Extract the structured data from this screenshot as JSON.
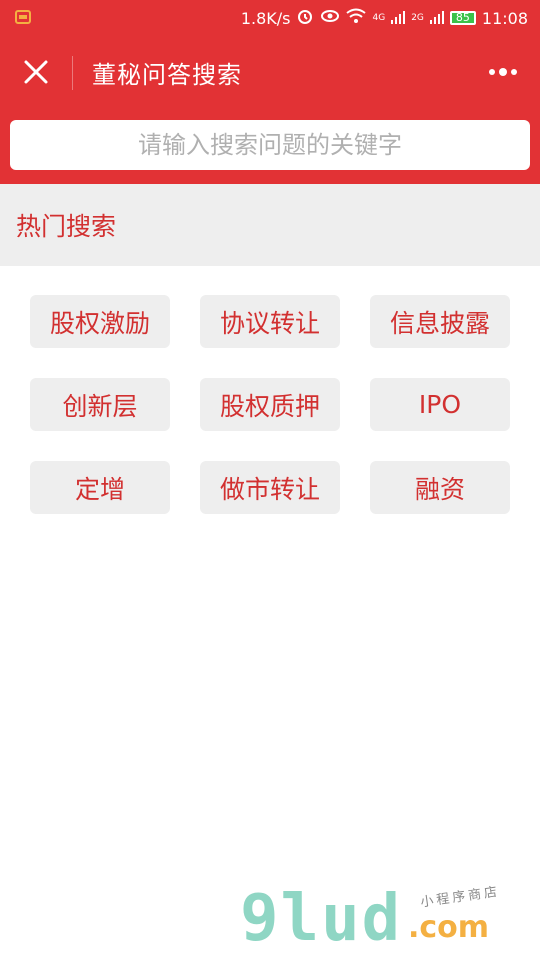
{
  "status_bar": {
    "network_speed": "1.8K/s",
    "net_type_1": "4G",
    "net_type_2": "2G",
    "battery": "85",
    "time": "11:08"
  },
  "navbar": {
    "title": "董秘问答搜索"
  },
  "search": {
    "placeholder": "请输入搜索问题的关键字"
  },
  "hot_search": {
    "title": "热门搜索",
    "tags": [
      "股权激励",
      "协议转让",
      "信息披露",
      "创新层",
      "股权质押",
      "IPO",
      "定增",
      "做市转让",
      "融资"
    ]
  },
  "watermark": {
    "logo": "9lud",
    "domain": ".com",
    "subtitle": "小程序商店"
  },
  "colors": {
    "brand_red": "#e23235",
    "tag_text": "#d23030",
    "tag_bg": "#eeeeee"
  }
}
